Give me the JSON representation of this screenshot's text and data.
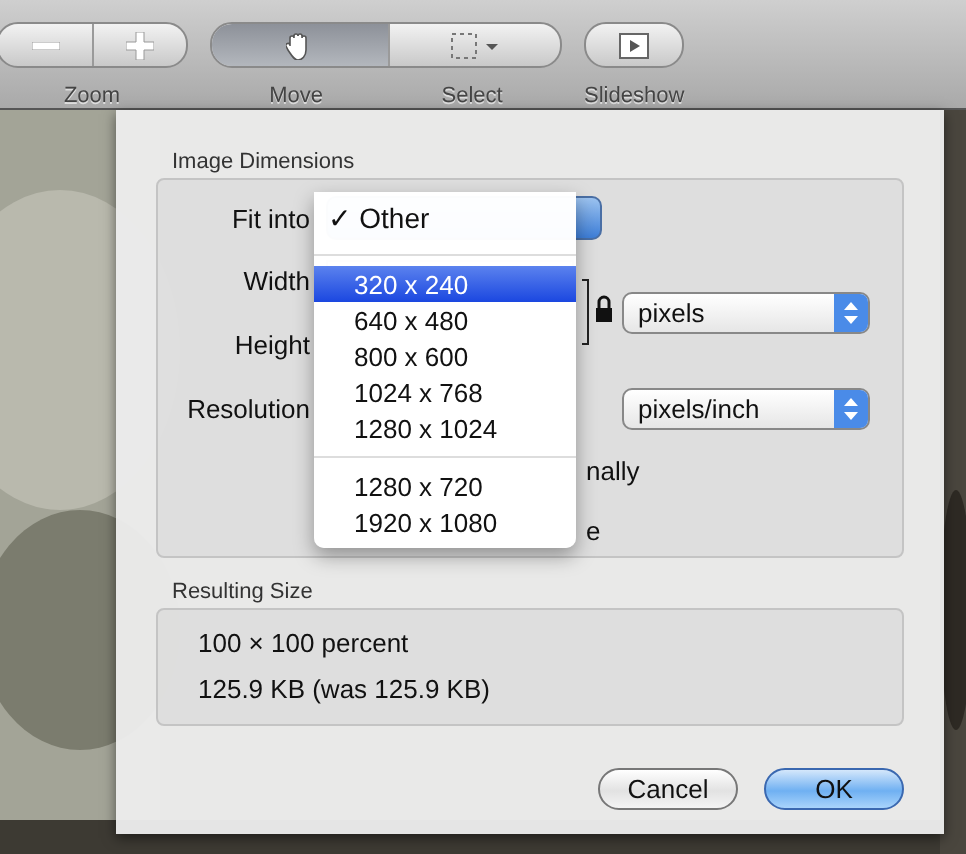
{
  "toolbar": {
    "groups": [
      {
        "label": "Zoom",
        "segments": [
          {
            "kind": "minus",
            "selected": false
          },
          {
            "kind": "plus",
            "selected": false
          }
        ]
      },
      {
        "label_parts": [
          "Move",
          "Select"
        ],
        "segments": [
          {
            "kind": "hand",
            "selected": true
          },
          {
            "kind": "marquee",
            "selected": false
          }
        ]
      },
      {
        "label": "Slideshow",
        "segments": [
          {
            "kind": "slideshow",
            "selected": false
          }
        ]
      }
    ]
  },
  "dialog": {
    "dimensions": {
      "title": "Image Dimensions",
      "rows": [
        {
          "kind": "popup",
          "label": "Fit into"
        },
        {
          "kind": "field",
          "label": "Width",
          "unit": "pixels"
        },
        {
          "kind": "covered",
          "label": "Height"
        },
        {
          "kind": "covered",
          "label": "Resolution",
          "unit": "pixels/inch"
        }
      ],
      "option_fragments": [
        "nally",
        "e"
      ],
      "menu": {
        "items": [
          {
            "kind": "item",
            "check": "✓",
            "label": "Other",
            "selected": false
          },
          {
            "kind": "separator"
          },
          {
            "kind": "item",
            "label": "320 x 240",
            "selected": true
          },
          {
            "kind": "item",
            "label": "640 x 480",
            "selected": false
          },
          {
            "kind": "item",
            "label": "800 x 600",
            "selected": false
          },
          {
            "kind": "item",
            "label": "1024 x 768",
            "selected": false
          },
          {
            "kind": "item",
            "label": "1280 x 1024",
            "selected": false
          },
          {
            "kind": "separator"
          },
          {
            "kind": "item",
            "label": "1280 x 720",
            "selected": false
          },
          {
            "kind": "item",
            "label": "1920 x 1080",
            "selected": false
          }
        ]
      }
    },
    "result": {
      "title": "Resulting Size",
      "lines": [
        "100 × 100 percent",
        "125.9 KB (was 125.9 KB)"
      ]
    },
    "buttons": [
      {
        "label": "Cancel",
        "default": false
      },
      {
        "label": "OK",
        "default": true
      }
    ]
  }
}
